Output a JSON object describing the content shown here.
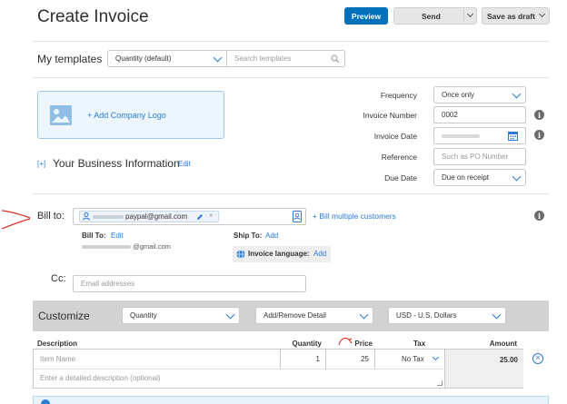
{
  "header": {
    "title": "Create Invoice",
    "preview_label": "Preview",
    "send_label": "Send",
    "save_label": "Save as draft"
  },
  "templates": {
    "label": "My templates",
    "selected": "Quantity (default)",
    "search_placeholder": "Search templates"
  },
  "logo": {
    "label": "+ Add Company Logo"
  },
  "business": {
    "toggle": "[+]",
    "title": "Your Business Information",
    "edit_label": "Edit"
  },
  "details": {
    "frequency_label": "Frequency",
    "frequency_value": "Once only",
    "invoice_number_label": "Invoice Number",
    "invoice_number_value": "0002",
    "invoice_date_label": "Invoice Date",
    "invoice_date_value": "",
    "reference_label": "Reference",
    "reference_placeholder": "Such as PO Number",
    "due_date_label": "Due Date",
    "due_date_value": "Due on receipt"
  },
  "billto": {
    "label": "Bill to:",
    "recipient": "paypal@gmail.com",
    "multiple_label": "+ Bill multiple customers",
    "bill_to_label": "Bill To:",
    "bill_to_edit": "Edit",
    "bill_to_email": "@gmail.com",
    "ship_to_label": "Ship To:",
    "ship_to_add": "Add",
    "language_label": "Invoice language:",
    "language_add": "Add"
  },
  "cc": {
    "label": "Cc:",
    "placeholder": "Email addresses"
  },
  "customize": {
    "label": "Customize",
    "quantity_select": "Quantity",
    "detail_select": "Add/Remove Detail",
    "currency_select": "USD - U.S. Dollars"
  },
  "items": {
    "headers": {
      "description": "Description",
      "quantity": "Quantity",
      "price": "Price",
      "tax": "Tax",
      "amount": "Amount"
    },
    "rows": [
      {
        "name_placeholder": "Item Name",
        "quantity": "1",
        "price": "25",
        "tax": "No Tax",
        "amount": "25.00",
        "description_placeholder": "Enter a detailed description (optional)"
      }
    ]
  },
  "colors": {
    "primary": "#0070ba",
    "link": "#2b7bd5",
    "annotation": "#d93025",
    "customize_bg": "#d2d2d2"
  },
  "icons": [
    "chevron-down-icon",
    "search-icon",
    "image-icon",
    "calendar-icon",
    "info-icon",
    "user-icon",
    "pencil-icon",
    "close-icon",
    "contacts-icon",
    "globe-icon",
    "remove-circle-icon"
  ]
}
